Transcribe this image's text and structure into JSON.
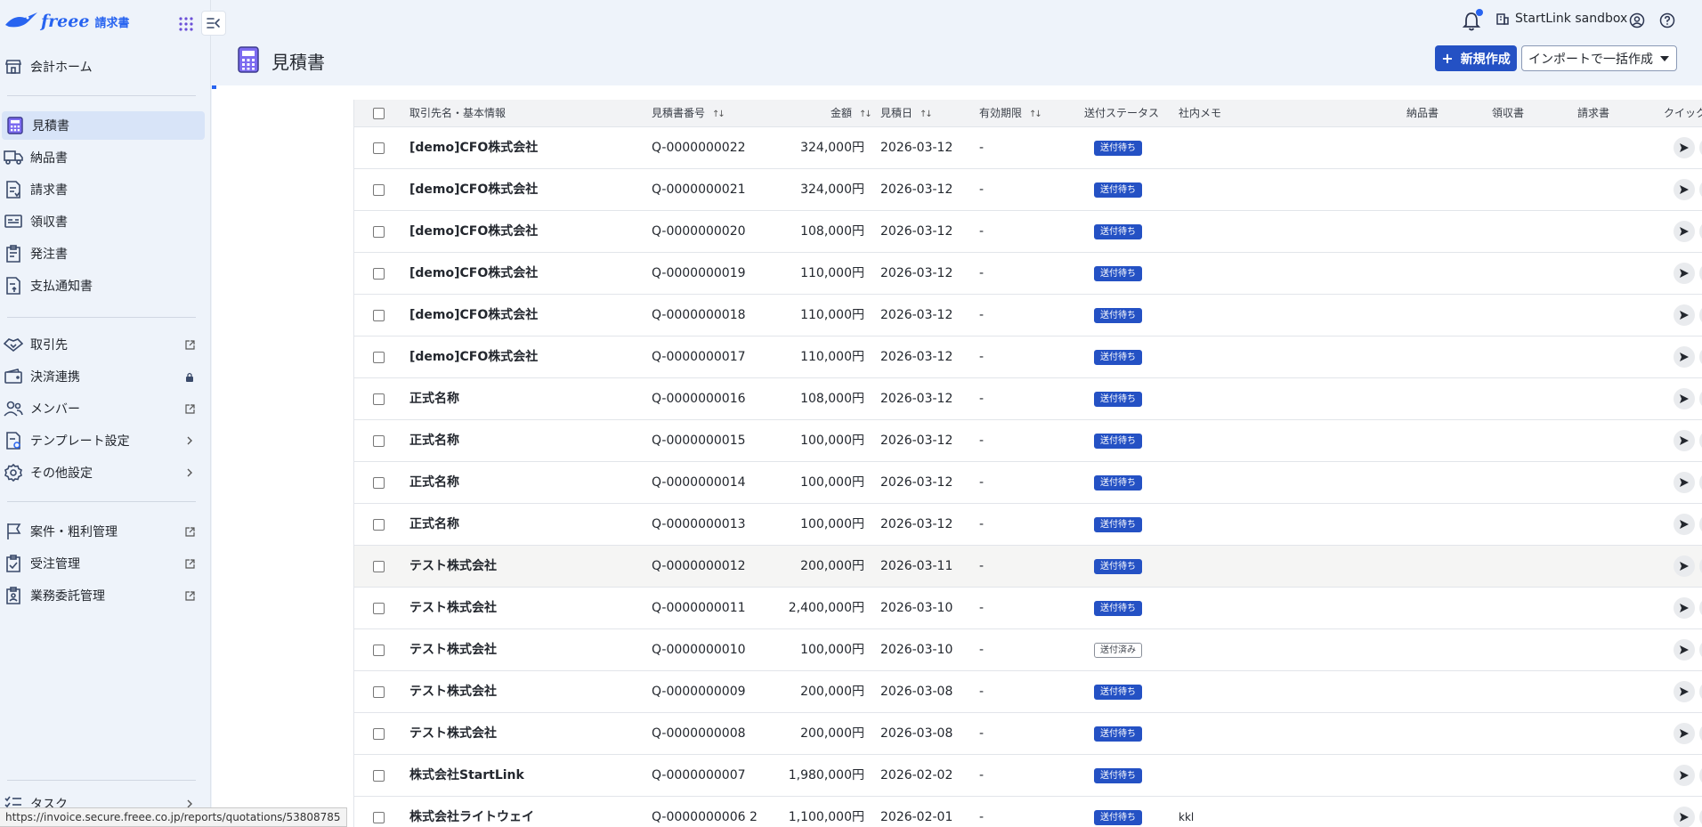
{
  "app": {
    "brand": "freee",
    "product": "請求書"
  },
  "sidebar": {
    "groups": [
      [
        {
          "key": "home",
          "label": "会計ホーム",
          "icon": "store-icon",
          "trail": ""
        }
      ],
      [
        {
          "key": "quotations",
          "label": "見積書",
          "icon": "calculator-icon",
          "trail": "",
          "active": true
        },
        {
          "key": "delivery",
          "label": "納品書",
          "icon": "truck-icon",
          "trail": ""
        },
        {
          "key": "invoices",
          "label": "請求書",
          "icon": "invoice-icon",
          "trail": ""
        },
        {
          "key": "receipts",
          "label": "領収書",
          "icon": "receipt-icon",
          "trail": ""
        },
        {
          "key": "purchase-orders",
          "label": "発注書",
          "icon": "clipboard-icon",
          "trail": ""
        },
        {
          "key": "payment-notices",
          "label": "支払通知書",
          "icon": "payment-doc-icon",
          "trail": ""
        }
      ],
      [
        {
          "key": "partners",
          "label": "取引先",
          "icon": "handshake-icon",
          "trail": "external"
        },
        {
          "key": "payment-links",
          "label": "決済連携",
          "icon": "wallet-icon",
          "trail": "lock"
        },
        {
          "key": "members",
          "label": "メンバー",
          "icon": "people-icon",
          "trail": "external"
        },
        {
          "key": "templates",
          "label": "テンプレート設定",
          "icon": "template-icon",
          "trail": "chevron"
        },
        {
          "key": "other-settings",
          "label": "その他設定",
          "icon": "gear-icon",
          "trail": "chevron"
        }
      ],
      [
        {
          "key": "projects",
          "label": "案件・粗利管理",
          "icon": "flag-icon",
          "trail": "external"
        },
        {
          "key": "orders",
          "label": "受注管理",
          "icon": "order-icon",
          "trail": "external"
        },
        {
          "key": "outsourcing",
          "label": "業務委託管理",
          "icon": "contract-icon",
          "trail": "external"
        }
      ]
    ],
    "task": {
      "label": "タスク",
      "icon": "checklist-icon"
    }
  },
  "status_url": "https://invoice.secure.freee.co.jp/reports/quotations/53808785",
  "header": {
    "org_name": "StartLink sandbox",
    "page_title": "見積書",
    "new_button": "新規作成",
    "import_button": "インポートで一括作成"
  },
  "table": {
    "columns": {
      "partner": "取引先名・基本情報",
      "number": "見積書番号",
      "amount": "金額",
      "date": "見積日",
      "expiry": "有効期限",
      "status": "送付ステータス",
      "memo": "社内メモ",
      "delivery": "納品書",
      "receipt": "領収書",
      "invoice": "請求書",
      "quick": "クイック"
    },
    "rows": [
      {
        "partner": "[demo]CFO株式会社",
        "number": "Q-0000000022",
        "amount": "324,000円",
        "date": "2026-03-12",
        "expiry": "-",
        "status": "送付待ち",
        "status_kind": "pending",
        "memo": ""
      },
      {
        "partner": "[demo]CFO株式会社",
        "number": "Q-0000000021",
        "amount": "324,000円",
        "date": "2026-03-12",
        "expiry": "-",
        "status": "送付待ち",
        "status_kind": "pending",
        "memo": ""
      },
      {
        "partner": "[demo]CFO株式会社",
        "number": "Q-0000000020",
        "amount": "108,000円",
        "date": "2026-03-12",
        "expiry": "-",
        "status": "送付待ち",
        "status_kind": "pending",
        "memo": ""
      },
      {
        "partner": "[demo]CFO株式会社",
        "number": "Q-0000000019",
        "amount": "110,000円",
        "date": "2026-03-12",
        "expiry": "-",
        "status": "送付待ち",
        "status_kind": "pending",
        "memo": ""
      },
      {
        "partner": "[demo]CFO株式会社",
        "number": "Q-0000000018",
        "amount": "110,000円",
        "date": "2026-03-12",
        "expiry": "-",
        "status": "送付待ち",
        "status_kind": "pending",
        "memo": ""
      },
      {
        "partner": "[demo]CFO株式会社",
        "number": "Q-0000000017",
        "amount": "110,000円",
        "date": "2026-03-12",
        "expiry": "-",
        "status": "送付待ち",
        "status_kind": "pending",
        "memo": ""
      },
      {
        "partner": "正式名称",
        "number": "Q-0000000016",
        "amount": "108,000円",
        "date": "2026-03-12",
        "expiry": "-",
        "status": "送付待ち",
        "status_kind": "pending",
        "memo": ""
      },
      {
        "partner": "正式名称",
        "number": "Q-0000000015",
        "amount": "100,000円",
        "date": "2026-03-12",
        "expiry": "-",
        "status": "送付待ち",
        "status_kind": "pending",
        "memo": ""
      },
      {
        "partner": "正式名称",
        "number": "Q-0000000014",
        "amount": "100,000円",
        "date": "2026-03-12",
        "expiry": "-",
        "status": "送付待ち",
        "status_kind": "pending",
        "memo": ""
      },
      {
        "partner": "正式名称",
        "number": "Q-0000000013",
        "amount": "100,000円",
        "date": "2026-03-12",
        "expiry": "-",
        "status": "送付待ち",
        "status_kind": "pending",
        "memo": ""
      },
      {
        "partner": "テスト株式会社",
        "number": "Q-0000000012",
        "amount": "200,000円",
        "date": "2026-03-11",
        "expiry": "-",
        "status": "送付待ち",
        "status_kind": "pending",
        "memo": "",
        "hover": true
      },
      {
        "partner": "テスト株式会社",
        "number": "Q-0000000011",
        "amount": "2,400,000円",
        "date": "2026-03-10",
        "expiry": "-",
        "status": "送付待ち",
        "status_kind": "pending",
        "memo": ""
      },
      {
        "partner": "テスト株式会社",
        "number": "Q-0000000010",
        "amount": "100,000円",
        "date": "2026-03-10",
        "expiry": "-",
        "status": "送付済み",
        "status_kind": "sent",
        "memo": ""
      },
      {
        "partner": "テスト株式会社",
        "number": "Q-0000000009",
        "amount": "200,000円",
        "date": "2026-03-08",
        "expiry": "-",
        "status": "送付待ち",
        "status_kind": "pending",
        "memo": ""
      },
      {
        "partner": "テスト株式会社",
        "number": "Q-0000000008",
        "amount": "200,000円",
        "date": "2026-03-08",
        "expiry": "-",
        "status": "送付待ち",
        "status_kind": "pending",
        "memo": ""
      },
      {
        "partner": "株式会社StartLink",
        "number": "Q-0000000007",
        "amount": "1,980,000円",
        "date": "2026-02-02",
        "expiry": "-",
        "status": "送付待ち",
        "status_kind": "pending",
        "memo": ""
      },
      {
        "partner": "株式会社ライトウェイ",
        "number": "Q-0000000006 2",
        "amount": "1,100,000円",
        "date": "2026-02-01",
        "expiry": "-",
        "status": "送付待ち",
        "status_kind": "pending",
        "memo": "kkl"
      }
    ]
  },
  "colors": {
    "accent": "#2864f0",
    "primary_button": "#2451c4",
    "sidebar_bg": "#eef3fa",
    "active_item": "#d8e4f8"
  }
}
